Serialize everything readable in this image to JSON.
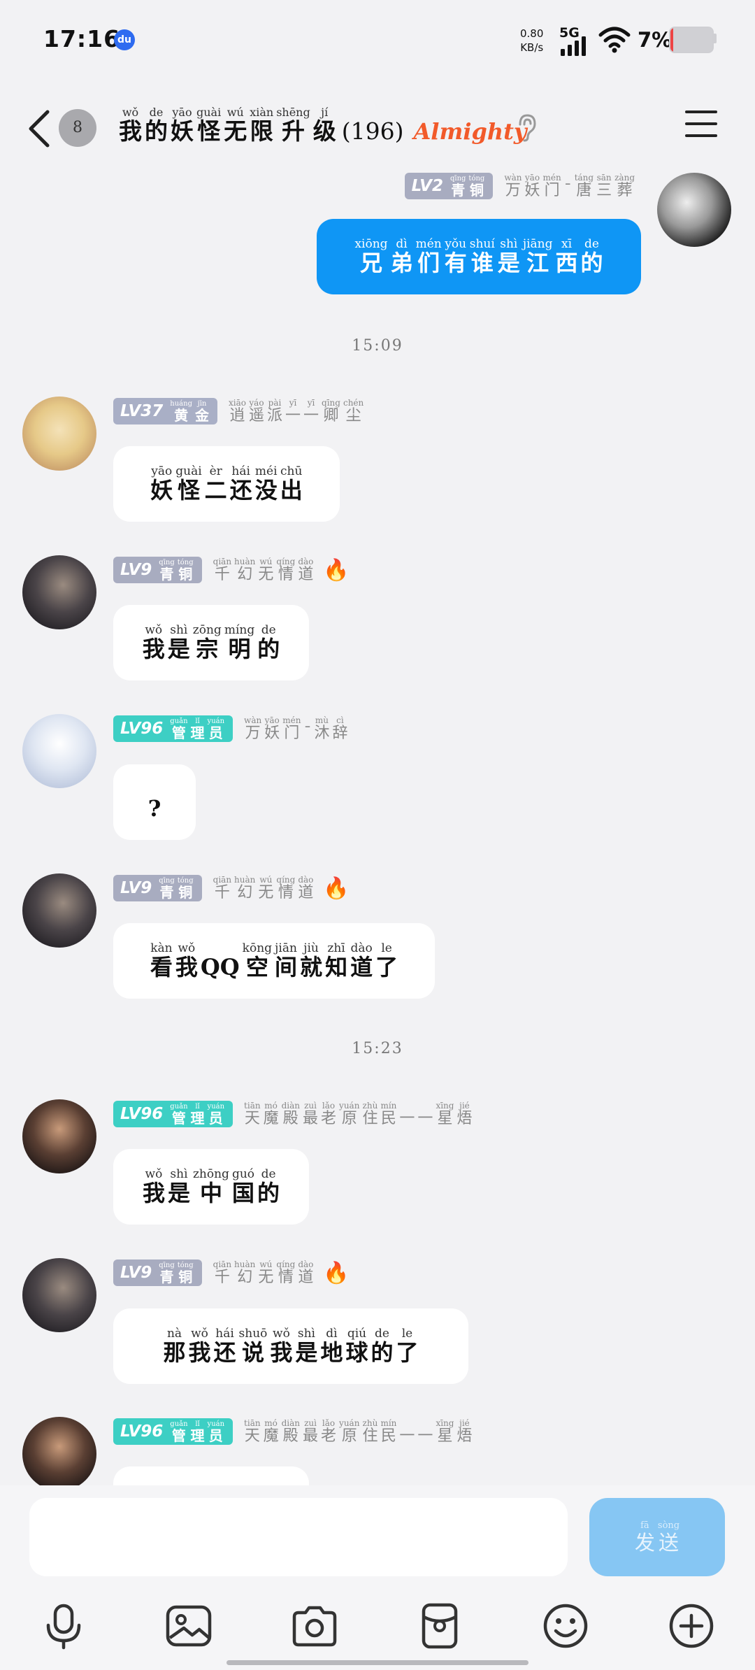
{
  "status": {
    "time": "17:16",
    "speed_value": "0.80",
    "speed_unit": "KB/s",
    "network": "5G",
    "battery": "7%",
    "battery_level": 0.07
  },
  "header": {
    "unread": "8",
    "title_chars": [
      {
        "py": "wǒ",
        "hz": "我"
      },
      {
        "py": "de",
        "hz": "的"
      },
      {
        "py": "yāo",
        "hz": "妖"
      },
      {
        "py": "guài",
        "hz": "怪"
      },
      {
        "py": "wú",
        "hz": "无"
      },
      {
        "py": "xiàn",
        "hz": "限"
      },
      {
        "py": "shēng",
        "hz": "升"
      },
      {
        "py": "jí",
        "hz": "级"
      }
    ],
    "count": "(196)",
    "badge": "Almighty"
  },
  "messages": [
    {
      "id": "m0",
      "lv": "LV2",
      "rank": [
        {
          "py": "qīng",
          "hz": "青"
        },
        {
          "py": "tóng",
          "hz": "铜"
        }
      ],
      "nick": [
        {
          "py": "wàn",
          "hz": "万"
        },
        {
          "py": "yāo",
          "hz": "妖"
        },
        {
          "py": "mén",
          "hz": "门"
        },
        {
          "py": "",
          "hz": "ˉ"
        },
        {
          "py": "táng",
          "hz": "唐"
        },
        {
          "py": "sān",
          "hz": "三"
        },
        {
          "py": "zàng",
          "hz": "葬"
        }
      ],
      "text": [
        {
          "py": "xiōng",
          "hz": "兄"
        },
        {
          "py": "dì",
          "hz": "弟"
        },
        {
          "py": "mén",
          "hz": "们"
        },
        {
          "py": "yǒu",
          "hz": "有"
        },
        {
          "py": "shuí",
          "hz": "谁"
        },
        {
          "py": "shì",
          "hz": "是"
        },
        {
          "py": "jiāng",
          "hz": "江"
        },
        {
          "py": "xī",
          "hz": "西"
        },
        {
          "py": "de",
          "hz": "的"
        }
      ]
    },
    {
      "id": "m1",
      "lv": "LV37",
      "rank": [
        {
          "py": "huáng",
          "hz": "黄"
        },
        {
          "py": "jīn",
          "hz": "金"
        }
      ],
      "nick": [
        {
          "py": "xiāo",
          "hz": "逍"
        },
        {
          "py": "yáo",
          "hz": "遥"
        },
        {
          "py": "pài",
          "hz": "派"
        },
        {
          "py": "yī",
          "hz": "一"
        },
        {
          "py": "yī",
          "hz": "一"
        },
        {
          "py": "qīng",
          "hz": "卿"
        },
        {
          "py": "chén",
          "hz": "尘"
        }
      ],
      "text": [
        {
          "py": "yāo",
          "hz": "妖"
        },
        {
          "py": "guài",
          "hz": "怪"
        },
        {
          "py": "èr",
          "hz": "二"
        },
        {
          "py": "hái",
          "hz": "还"
        },
        {
          "py": "méi",
          "hz": "没"
        },
        {
          "py": "chū",
          "hz": "出"
        }
      ]
    },
    {
      "id": "m2",
      "lv": "LV9",
      "rank": [
        {
          "py": "qīng",
          "hz": "青"
        },
        {
          "py": "tóng",
          "hz": "铜"
        }
      ],
      "nick": [
        {
          "py": "qiān",
          "hz": "千"
        },
        {
          "py": "huàn",
          "hz": "幻"
        },
        {
          "py": "wú",
          "hz": "无"
        },
        {
          "py": "qíng",
          "hz": "情"
        },
        {
          "py": "dào",
          "hz": "道"
        }
      ],
      "text": [
        {
          "py": "wǒ",
          "hz": "我"
        },
        {
          "py": "shì",
          "hz": "是"
        },
        {
          "py": "zōng",
          "hz": "宗"
        },
        {
          "py": "míng",
          "hz": "明"
        },
        {
          "py": "de",
          "hz": "的"
        }
      ]
    },
    {
      "id": "m3",
      "lv": "LV96",
      "rank": [
        {
          "py": "guǎn",
          "hz": "管"
        },
        {
          "py": "lǐ",
          "hz": "理"
        },
        {
          "py": "yuán",
          "hz": "员"
        }
      ],
      "nick": [
        {
          "py": "wàn",
          "hz": "万"
        },
        {
          "py": "yāo",
          "hz": "妖"
        },
        {
          "py": "mén",
          "hz": "门"
        },
        {
          "py": "",
          "hz": "ˉ"
        },
        {
          "py": "mù",
          "hz": "沐"
        },
        {
          "py": "cì",
          "hz": "辞"
        }
      ],
      "text": [
        {
          "py": "",
          "hz": "?"
        }
      ]
    },
    {
      "id": "m4",
      "lv": "LV9",
      "rank": [
        {
          "py": "qīng",
          "hz": "青"
        },
        {
          "py": "tóng",
          "hz": "铜"
        }
      ],
      "nick": [
        {
          "py": "qiān",
          "hz": "千"
        },
        {
          "py": "huàn",
          "hz": "幻"
        },
        {
          "py": "wú",
          "hz": "无"
        },
        {
          "py": "qíng",
          "hz": "情"
        },
        {
          "py": "dào",
          "hz": "道"
        }
      ],
      "text": [
        {
          "py": "kàn",
          "hz": "看"
        },
        {
          "py": "wǒ",
          "hz": "我"
        },
        {
          "py": "",
          "hz": "QQ"
        },
        {
          "py": "kōng",
          "hz": "空"
        },
        {
          "py": "jiān",
          "hz": "间"
        },
        {
          "py": "jiù",
          "hz": "就"
        },
        {
          "py": "zhī",
          "hz": "知"
        },
        {
          "py": "dào",
          "hz": "道"
        },
        {
          "py": "le",
          "hz": "了"
        }
      ]
    },
    {
      "id": "m5",
      "lv": "LV96",
      "rank": [
        {
          "py": "guǎn",
          "hz": "管"
        },
        {
          "py": "lǐ",
          "hz": "理"
        },
        {
          "py": "yuán",
          "hz": "员"
        }
      ],
      "nick": [
        {
          "py": "tiān",
          "hz": "天"
        },
        {
          "py": "mó",
          "hz": "魔"
        },
        {
          "py": "diàn",
          "hz": "殿"
        },
        {
          "py": "zuì",
          "hz": "最"
        },
        {
          "py": "lǎo",
          "hz": "老"
        },
        {
          "py": "yuán",
          "hz": "原"
        },
        {
          "py": "zhù",
          "hz": "住"
        },
        {
          "py": "mín",
          "hz": "民"
        },
        {
          "py": "",
          "hz": "一"
        },
        {
          "py": "",
          "hz": "一"
        },
        {
          "py": "xīng",
          "hz": "星"
        },
        {
          "py": "jié",
          "hz": "焐"
        }
      ],
      "text": [
        {
          "py": "wǒ",
          "hz": "我"
        },
        {
          "py": "shì",
          "hz": "是"
        },
        {
          "py": "zhōng",
          "hz": "中"
        },
        {
          "py": "guó",
          "hz": "国"
        },
        {
          "py": "de",
          "hz": "的"
        }
      ]
    },
    {
      "id": "m6",
      "lv": "LV9",
      "rank": [
        {
          "py": "qīng",
          "hz": "青"
        },
        {
          "py": "tóng",
          "hz": "铜"
        }
      ],
      "nick": [
        {
          "py": "qiān",
          "hz": "千"
        },
        {
          "py": "huàn",
          "hz": "幻"
        },
        {
          "py": "wú",
          "hz": "无"
        },
        {
          "py": "qíng",
          "hz": "情"
        },
        {
          "py": "dào",
          "hz": "道"
        }
      ],
      "text": [
        {
          "py": "nà",
          "hz": "那"
        },
        {
          "py": "wǒ",
          "hz": "我"
        },
        {
          "py": "hái",
          "hz": "还"
        },
        {
          "py": "shuō",
          "hz": "说"
        },
        {
          "py": "wǒ",
          "hz": "我"
        },
        {
          "py": "shì",
          "hz": "是"
        },
        {
          "py": "dì",
          "hz": "地"
        },
        {
          "py": "qiú",
          "hz": "球"
        },
        {
          "py": "de",
          "hz": "的"
        },
        {
          "py": "le",
          "hz": "了"
        }
      ]
    },
    {
      "id": "m7",
      "lv": "LV96",
      "rank": [
        {
          "py": "guǎn",
          "hz": "管"
        },
        {
          "py": "lǐ",
          "hz": "理"
        },
        {
          "py": "yuán",
          "hz": "员"
        }
      ],
      "nick": [
        {
          "py": "tiān",
          "hz": "天"
        },
        {
          "py": "mó",
          "hz": "魔"
        },
        {
          "py": "diàn",
          "hz": "殿"
        },
        {
          "py": "zuì",
          "hz": "最"
        },
        {
          "py": "lǎo",
          "hz": "老"
        },
        {
          "py": "yuán",
          "hz": "原"
        },
        {
          "py": "zhù",
          "hz": "住"
        },
        {
          "py": "mín",
          "hz": "民"
        },
        {
          "py": "",
          "hz": "一"
        },
        {
          "py": "",
          "hz": "一"
        },
        {
          "py": "xīng",
          "hz": "星"
        },
        {
          "py": "jié",
          "hz": "焐"
        }
      ],
      "text": []
    }
  ],
  "timestamps": [
    "15:09",
    "15:23"
  ],
  "input": {
    "send": [
      {
        "py": "fā",
        "hz": "发"
      },
      {
        "py": "sòng",
        "hz": "送"
      }
    ]
  },
  "toolbar": [
    "microphone-icon",
    "image-icon",
    "camera-icon",
    "red-packet-icon",
    "emoji-icon",
    "plus-icon"
  ],
  "colors": {
    "accent": "#0f96f5",
    "admin": "#3dcfc4",
    "member": "#a8acc0",
    "title_badge": "#f25a2a"
  }
}
